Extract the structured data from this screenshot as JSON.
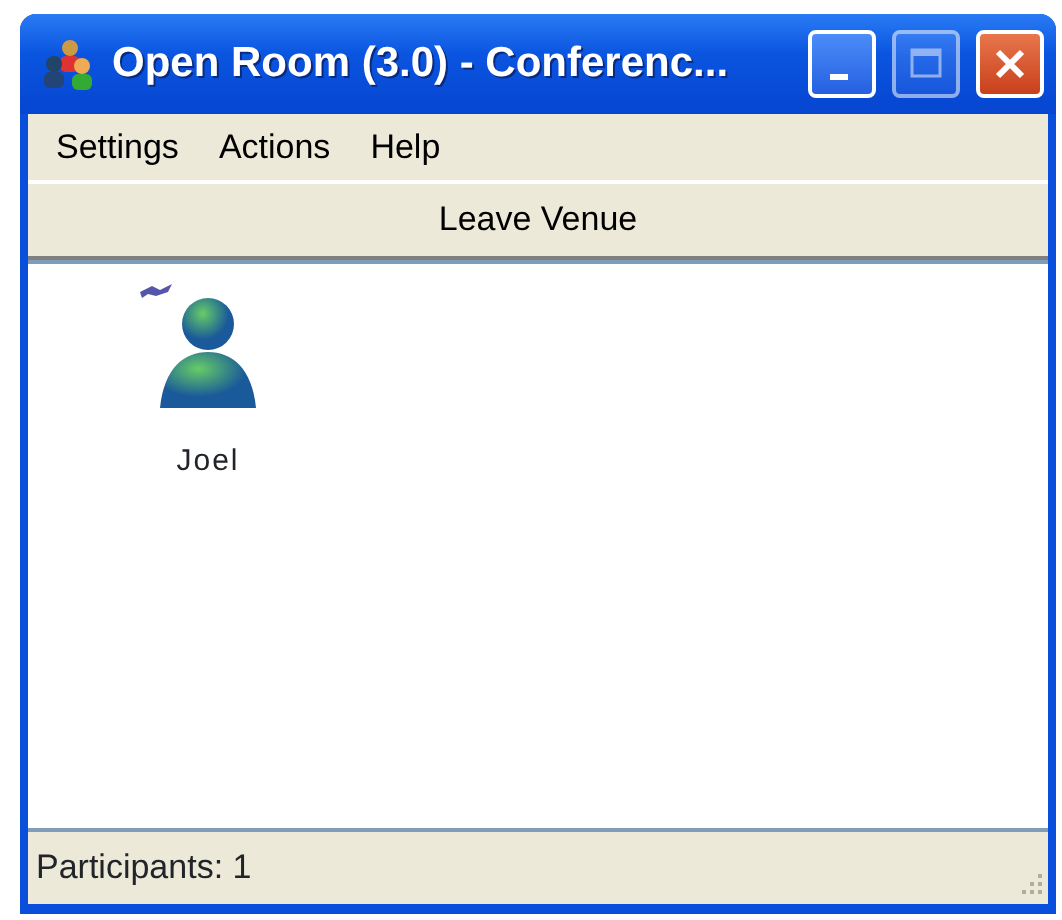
{
  "window": {
    "title": "Open Room (3.0) - Conferenc..."
  },
  "menu": [
    "Settings",
    "Actions",
    "Help"
  ],
  "leave_button": "Leave Venue",
  "participants": [
    {
      "name": "Joel"
    }
  ],
  "status_bar": "Participants: 1"
}
